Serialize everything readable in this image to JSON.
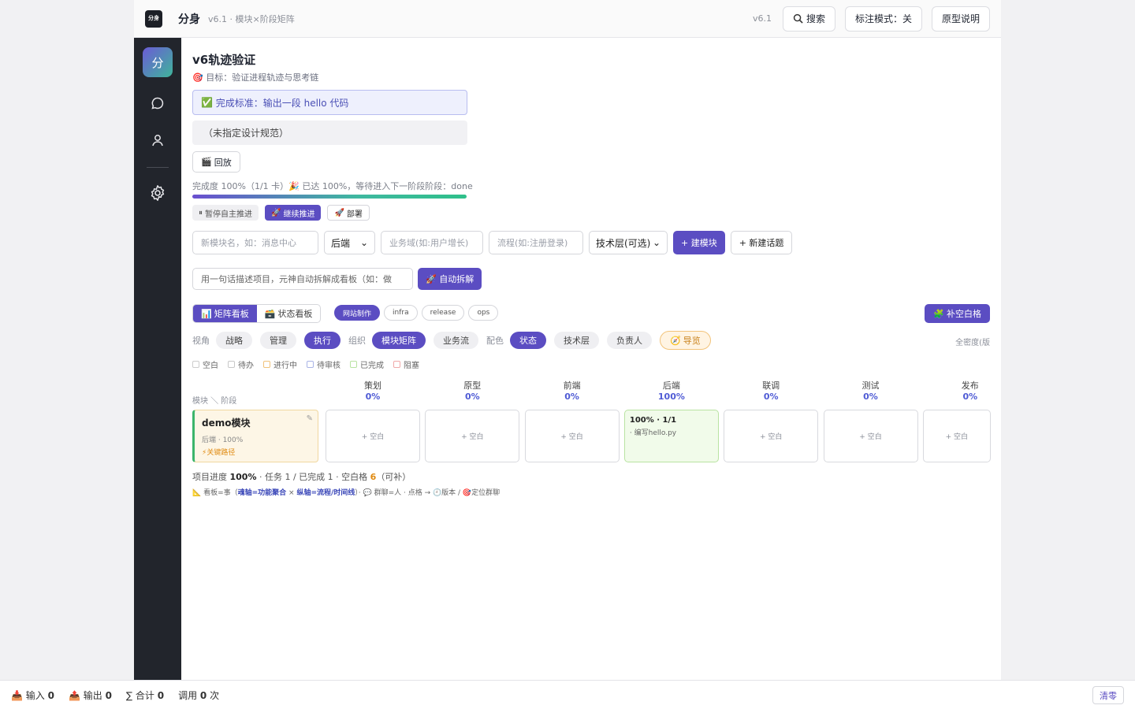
{
  "app": {
    "title": "分身",
    "subtitle": "v6.1 · 模块×阶段矩阵",
    "logo_text": "分身",
    "version": "v6.1",
    "search_label": "搜索",
    "annot_label": "标注模式：关",
    "proto_label": "原型说明"
  },
  "sidebar": {
    "logo": "分",
    "icons": [
      "chat-icon",
      "user-icon",
      "settings-icon"
    ]
  },
  "project": {
    "title": "v6轨迹验证",
    "goal": "目标：验证进程轨迹与思考链",
    "done_criteria": "完成标准：输出一段 hello 代码",
    "spec": "（未指定设计规范）",
    "replay": "回放",
    "progress_text": "完成度 100%（1/1 卡）🎉 已达 100%，等待进入下一阶段阶段：done",
    "progress_value": 1.0
  },
  "actions": {
    "pause": "暂停自主推进",
    "continue": "继续推进",
    "deploy": "部署"
  },
  "form": {
    "module_placeholder": "新模块名，如：消息中心",
    "side_select": "后端",
    "domain_placeholder": "业务域(如:用户增长)",
    "flow_placeholder": "流程(如:注册登录)",
    "tech_select": "技术层(可选)",
    "create_module": "+ 建模块",
    "new_topic": "+ 新建话题",
    "auto_placeholder": "用一句话描述项目，元神自动拆解成看板（如：做",
    "auto_split": "自动拆解"
  },
  "board": {
    "tabs": [
      "矩阵看板",
      "状态看板"
    ],
    "tags": [
      "网站制作",
      "infra",
      "release",
      "ops"
    ],
    "fill_blank": "补空白格"
  },
  "filters": {
    "view_label": "视角",
    "views": [
      "战略",
      "管理",
      "执行"
    ],
    "org_label": "组织",
    "orgs": [
      "模块矩阵",
      "业务流"
    ],
    "color_label": "配色",
    "colors": [
      "状态",
      "技术层",
      "负责人"
    ],
    "tour": "导览",
    "density": "全密度(版"
  },
  "legend": [
    {
      "label": "空白",
      "color": "#cccccc"
    },
    {
      "label": "待办",
      "color": "#c8c8c8"
    },
    {
      "label": "进行中",
      "color": "#f0c27a"
    },
    {
      "label": "待审核",
      "color": "#a9b4e6"
    },
    {
      "label": "已完成",
      "color": "#b9e3a2"
    },
    {
      "label": "阻塞",
      "color": "#f0a9a9"
    }
  ],
  "matrix": {
    "axis_label": "模块 ＼ 阶段",
    "stages": [
      {
        "name": "策划",
        "pct": "0%"
      },
      {
        "name": "原型",
        "pct": "0%"
      },
      {
        "name": "前端",
        "pct": "0%"
      },
      {
        "name": "后端",
        "pct": "100%"
      },
      {
        "name": "联调",
        "pct": "0%"
      },
      {
        "name": "测试",
        "pct": "0%"
      },
      {
        "name": "发布",
        "pct": "0%"
      }
    ],
    "module": {
      "name": "demo模块",
      "meta": "后端 · 100%",
      "critical": "⚡关键路径"
    },
    "empty_label": "+ 空白",
    "done_cell": {
      "header": "100% · 1/1",
      "task": "· 编写hello.py"
    }
  },
  "summary": {
    "prefix": "项目进度 ",
    "progress": "100%",
    "mid": " · 任务 1 / 已完成 1 · 空白格 ",
    "blank": "6",
    "suffix": "（可补）"
  },
  "footnote": {
    "a": "看板=事（",
    "b": "魂轴=功能聚合",
    "c": " × ",
    "d": "纵轴=流程/时间线",
    "e": "）· 💬 群聊=人 · 点格 → 🕘版本 / 🎯定位群聊"
  },
  "status": {
    "input_label": "输入",
    "input": "0",
    "output_label": "输出",
    "output": "0",
    "total_label": "∑ 合计",
    "total": "0",
    "calls_label": "调用",
    "calls": "0",
    "calls_unit": "次",
    "clear": "清零"
  }
}
